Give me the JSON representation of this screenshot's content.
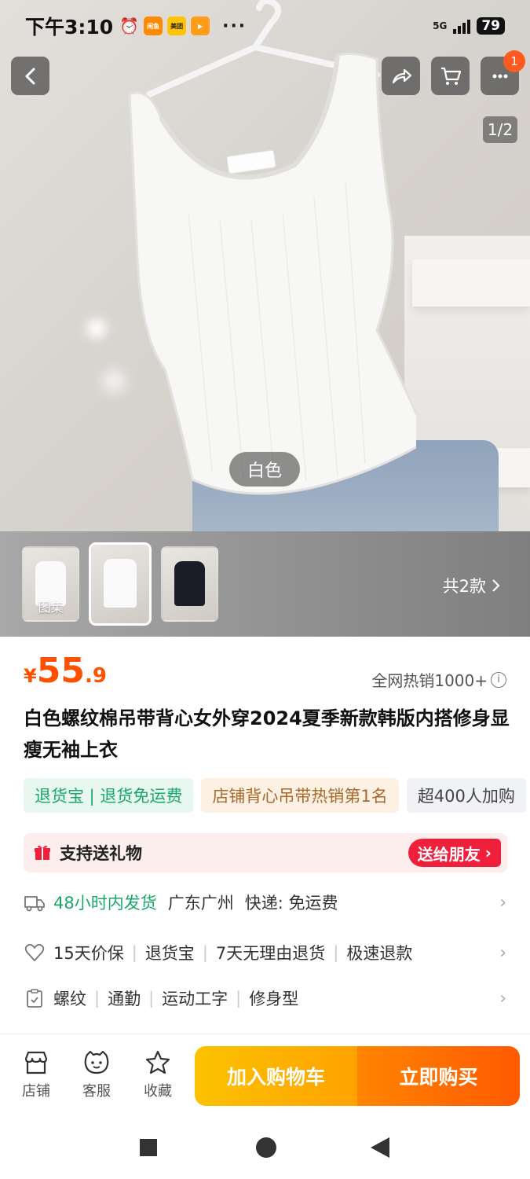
{
  "status_bar": {
    "time": "下午3:10",
    "app_icons": [
      "闲鱼",
      "美团"
    ],
    "more": "···",
    "network": "5G",
    "battery": "79"
  },
  "product_gallery": {
    "page_indicator": "1/2",
    "color_label": "白色",
    "cart_badge": "1",
    "thumbnails": [
      {
        "label": "图集"
      },
      {
        "label": ""
      },
      {
        "label": ""
      }
    ],
    "variants_link": "共2款"
  },
  "price": {
    "currency": "¥",
    "integer": "55",
    "decimal": ".9"
  },
  "hot_sales": "全网热销1000+",
  "title": "白色螺纹棉吊带背心女外穿2024夏季新款韩版内搭修身显瘦无袖上衣",
  "tags": [
    {
      "text": "退货宝 | 退货免运费"
    },
    {
      "text": "店铺背心吊带热销第1名"
    },
    {
      "text": "超400人加购"
    }
  ],
  "gift": {
    "text": "支持送礼物",
    "button": "送给朋友"
  },
  "shipping": {
    "highlight": "48小时内发货",
    "location": "广东广州",
    "courier": "快递: 免运费"
  },
  "guarantees": [
    "15天价保",
    "退货宝",
    "7天无理由退货",
    "极速退款"
  ],
  "attributes": [
    "螺纹",
    "通勤",
    "运动工字",
    "修身型"
  ],
  "bottom_bar": {
    "shop": "店铺",
    "service": "客服",
    "favorite": "收藏",
    "add_to_cart": "加入购物车",
    "buy_now": "立即购买"
  },
  "colors": {
    "price": "#ff5000",
    "green": "#1aa86a",
    "gift_red": "#f0203c",
    "cart_yellow": "#fcc200",
    "buy_orange": "#ff5a00"
  }
}
